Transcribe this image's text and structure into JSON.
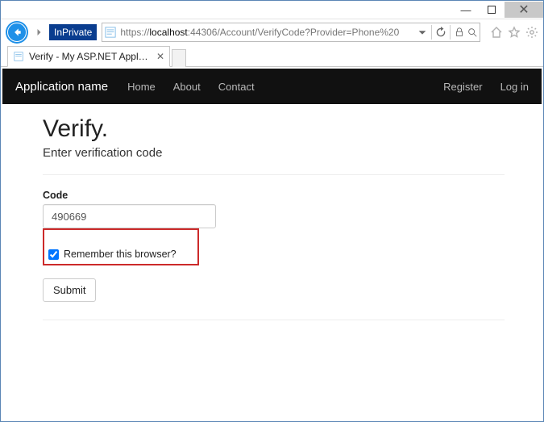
{
  "window": {
    "minimize": "—",
    "maximize": "▢",
    "close": "✕"
  },
  "browser": {
    "inprivate_label": "InPrivate",
    "url_prefix": "https://",
    "url_host": "localhost",
    "url_rest": ":44306/Account/VerifyCode?Provider=Phone%20",
    "tab_title": "Verify - My ASP.NET Applic..."
  },
  "nav": {
    "brand": "Application name",
    "links": [
      "Home",
      "About",
      "Contact"
    ],
    "right_links": [
      "Register",
      "Log in"
    ]
  },
  "page": {
    "heading": "Verify.",
    "subtitle": "Enter verification code",
    "code_label": "Code",
    "code_value": "490669",
    "remember_label": "Remember this browser?",
    "remember_checked": true,
    "submit_label": "Submit"
  }
}
